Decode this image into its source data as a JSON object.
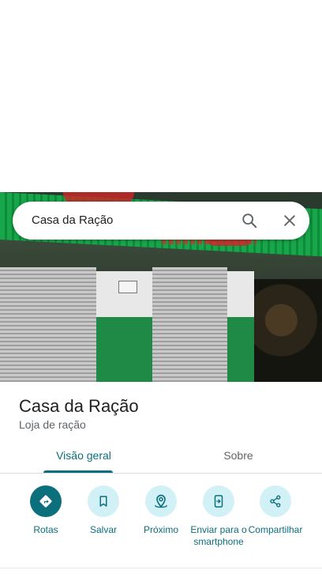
{
  "search": {
    "query": "Casa da Ração"
  },
  "place": {
    "name": "Casa da Ração",
    "category": "Loja de ração"
  },
  "tabs": [
    {
      "label": "Visão geral",
      "selected": true
    },
    {
      "label": "Sobre",
      "selected": false
    }
  ],
  "actions": [
    {
      "label": "Rotas",
      "icon": "directions-icon"
    },
    {
      "label": "Salvar",
      "icon": "bookmark-icon"
    },
    {
      "label": "Próximo",
      "icon": "nearby-icon"
    },
    {
      "label": "Enviar para o smartphone",
      "icon": "send-to-phone-icon"
    },
    {
      "label": "Compartilhar",
      "icon": "share-icon"
    }
  ],
  "colors": {
    "accent": "#0b6f7c",
    "action_circle": "#d2f1f7"
  }
}
